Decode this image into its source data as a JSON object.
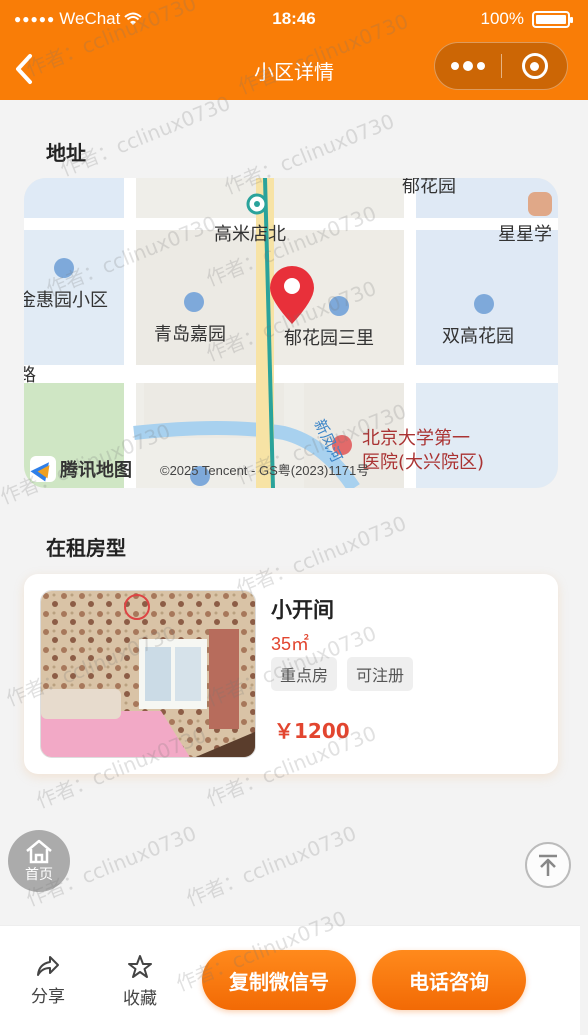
{
  "status_bar": {
    "carrier": "WeChat",
    "time": "18:46",
    "battery": "100%"
  },
  "nav": {
    "title": "小区详情"
  },
  "sections": {
    "address": "地址",
    "rental_types": "在租房型"
  },
  "map": {
    "labels": {
      "north": "郁花园",
      "gaomi": "高米店北",
      "star": "星星学",
      "huiyuan": "金惠园小区",
      "qingdao": "青岛嘉园",
      "yuhua": "郁花园三里",
      "shuanggao": "双高花园",
      "road": "路",
      "river": "新凤河",
      "hospital_1": "北京大学第一",
      "hospital_2": "医院(大兴院区)"
    },
    "brand": "腾讯地图",
    "copyright": "©2025 Tencent - GS粤(2023)1171号"
  },
  "listing": {
    "name": "小开间",
    "area": "35㎡",
    "tags": [
      "重点房",
      "可注册"
    ],
    "price": "￥1200"
  },
  "home_fab": {
    "label": "首页"
  },
  "bottom_bar": {
    "share": "分享",
    "favorite": "收藏",
    "copy_wechat": "复制微信号",
    "phone": "电话咨询"
  },
  "watermark": "作者：cclinux0730"
}
